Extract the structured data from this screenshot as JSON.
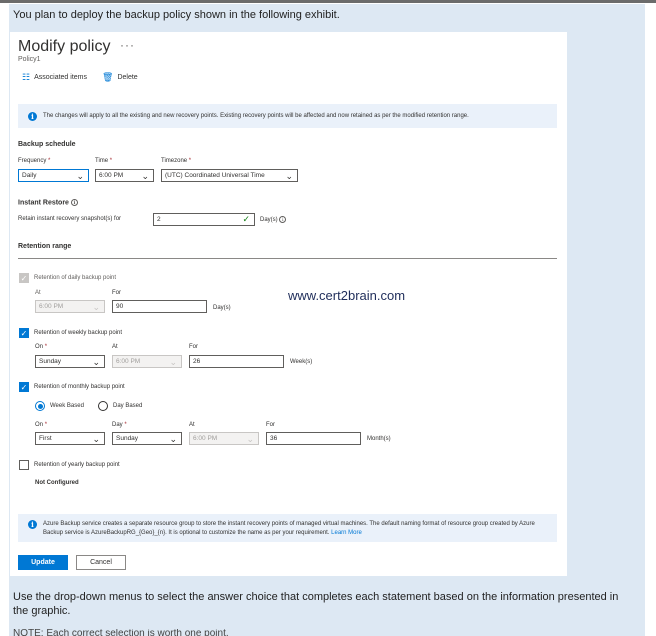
{
  "question": "You plan to deploy the backup policy shown in the following exhibit.",
  "footer_question": "Use the drop-down menus to select the answer choice that completes each statement based on the information presented in the graphic.",
  "footer_cut": "NOTE: Each correct selection is worth one point.",
  "watermark": "www.cert2brain.com",
  "blade": {
    "title": "Modify policy",
    "more": "···",
    "subtitle": "Policy1",
    "associated_items": "Associated items",
    "delete": "Delete",
    "info": "The changes will apply to all the existing and new recovery points. Existing recovery points will be affected and now retained as per the modified retention range."
  },
  "schedule": {
    "heading": "Backup schedule",
    "frequency_label": "Frequency",
    "frequency_value": "Daily",
    "time_label": "Time",
    "time_value": "6:00 PM",
    "timezone_label": "Timezone",
    "timezone_value": "(UTC) Coordinated Universal Time",
    "required_mark": "*"
  },
  "instant_restore": {
    "heading": "Instant Restore",
    "retain_label": "Retain instant recovery snapshot(s) for",
    "retain_value": "2",
    "unit": "Day(s)"
  },
  "retention": {
    "heading": "Retention range",
    "daily": {
      "label": "Retention of daily backup point",
      "checked": true,
      "disabled": true,
      "at_label": "At",
      "at_value": "6:00 PM",
      "for_label": "For",
      "for_value": "90",
      "unit": "Day(s)"
    },
    "weekly": {
      "label": "Retention of weekly backup point",
      "checked": true,
      "on_label": "On",
      "on_value": "Sunday",
      "at_label": "At",
      "at_value": "6:00 PM",
      "for_label": "For",
      "for_value": "26",
      "unit": "Week(s)"
    },
    "monthly": {
      "label": "Retention of monthly backup point",
      "checked": true,
      "week_based": "Week Based",
      "day_based": "Day Based",
      "selected": "Week Based",
      "on_label": "On",
      "on_value": "First",
      "day_label": "Day",
      "day_value": "Sunday",
      "at_label": "At",
      "at_value": "6:00 PM",
      "for_label": "For",
      "for_value": "36",
      "unit": "Month(s)"
    },
    "yearly": {
      "label": "Retention of yearly backup point",
      "checked": false,
      "status": "Not Configured"
    }
  },
  "info_bottom": {
    "text": "Azure Backup service creates a separate resource group to store the instant recovery points of managed virtual machines. The default naming format of resource group created by Azure Backup service is AzureBackupRG_{Geo}_{n}. It is optional to customize the name as per your requirement.",
    "link": "Learn More"
  },
  "buttons": {
    "update": "Update",
    "cancel": "Cancel"
  },
  "icons": {
    "chevron": "chevron-down-icon",
    "check": "checkmark-icon",
    "info": "info-icon"
  },
  "colors": {
    "accent": "#0078d4",
    "background": "#dde8f3",
    "info_bar": "#eaf1fa",
    "required": "#a4262c"
  }
}
